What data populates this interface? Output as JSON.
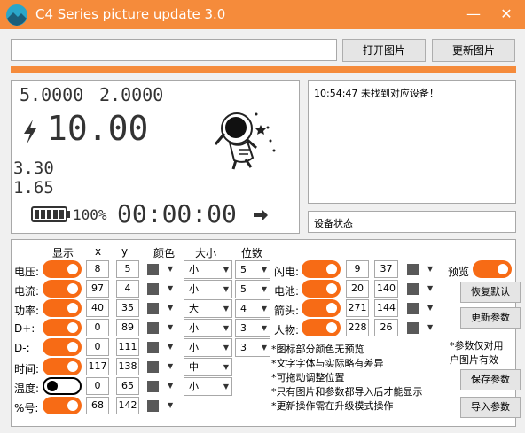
{
  "app": {
    "title": "C4 Series picture update 3.0"
  },
  "window": {
    "minimize": "—",
    "close": "✕"
  },
  "top": {
    "path_value": "",
    "open_image_label": "打开图片",
    "update_image_label": "更新图片",
    "progress_percent": 100
  },
  "preview": {
    "voltage": "5.0000",
    "current": "2.0000",
    "power": "10.00",
    "dp": "3.30",
    "dm": "1.65",
    "percent": "100%",
    "timer": "00:00:00"
  },
  "log": {
    "text": "10:54:47 未找到对应设备！"
  },
  "status": {
    "label": "设备状态"
  },
  "headers": {
    "show": "显示",
    "x": "x",
    "y": "y",
    "color": "颜色",
    "size": "大小",
    "digits": "位数"
  },
  "rows": [
    {
      "label": "电压:",
      "on": true,
      "x": "8",
      "y": "5",
      "size": "小",
      "digits": "5"
    },
    {
      "label": "电流:",
      "on": true,
      "x": "97",
      "y": "4",
      "size": "小",
      "digits": "5"
    },
    {
      "label": "功率:",
      "on": true,
      "x": "40",
      "y": "35",
      "size": "大",
      "digits": "4"
    },
    {
      "label": "D+:",
      "on": true,
      "x": "0",
      "y": "89",
      "size": "小",
      "digits": "3"
    },
    {
      "label": "D-:",
      "on": true,
      "x": "0",
      "y": "111",
      "size": "小",
      "digits": "3"
    },
    {
      "label": "时间:",
      "on": true,
      "x": "117",
      "y": "138",
      "size": "中",
      "digits": ""
    },
    {
      "label": "温度:",
      "on": false,
      "x": "0",
      "y": "65",
      "size": "小",
      "digits": ""
    },
    {
      "label": "%号:",
      "on": true,
      "x": "68",
      "y": "142",
      "size": "",
      "digits": ""
    }
  ],
  "right_rows": [
    {
      "label": "闪电:",
      "on": true,
      "x": "9",
      "y": "37"
    },
    {
      "label": "电池:",
      "on": true,
      "x": "20",
      "y": "140"
    },
    {
      "label": "箭头:",
      "on": true,
      "x": "271",
      "y": "144"
    },
    {
      "label": "人物:",
      "on": true,
      "x": "228",
      "y": "26"
    }
  ],
  "side": {
    "preview_label": "预览",
    "restore_default": "恢复默认",
    "update_params": "更新参数",
    "note_line1": "*参数仅对用",
    "note_line2": "户图片有效",
    "save_params": "保存参数",
    "import_params": "导入参数"
  },
  "notes": [
    "*图标部分颜色无预览",
    "*文字字体与实际略有差异",
    "*可拖动调整位置",
    "*只有图片和参数都导入后才能显示",
    "*更新操作需在升级模式操作"
  ],
  "colors": {
    "accent": "#f58b3b",
    "toggle_on": "#f76b15",
    "swatch": "#595959"
  }
}
